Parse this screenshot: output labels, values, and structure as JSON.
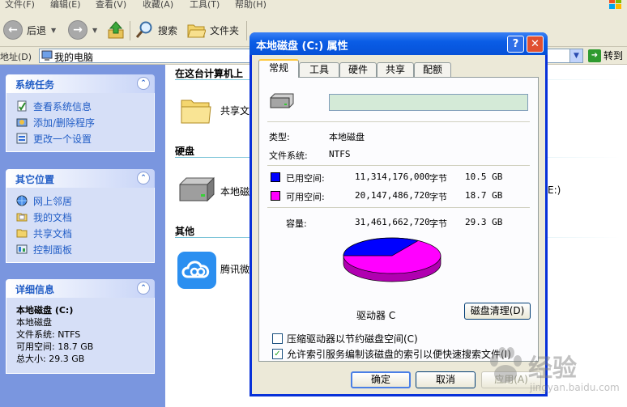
{
  "menubar": {
    "items": [
      "文件(F)",
      "编辑(E)",
      "查看(V)",
      "收藏(A)",
      "工具(T)",
      "帮助(H)"
    ]
  },
  "toolbar": {
    "back_label": "后退",
    "search_label": "搜索",
    "folders_label": "文件夹"
  },
  "addressbar": {
    "label": "地址(D)",
    "value": "我的电脑",
    "go_label": "转到"
  },
  "leftpane": {
    "system_tasks": {
      "title": "系统任务",
      "items": [
        "查看系统信息",
        "添加/删除程序",
        "更改一个设置"
      ]
    },
    "other_places": {
      "title": "其它位置",
      "items": [
        "网上邻居",
        "我的文档",
        "共享文档",
        "控制面板"
      ]
    },
    "details": {
      "title": "详细信息",
      "name": "本地磁盘 (C:)",
      "type": "本地磁盘",
      "filesystem": "文件系统: NTFS",
      "free": "可用空间: 18.7 GB",
      "total": "总大小: 29.3 GB"
    }
  },
  "content": {
    "group_files": "在这台计算机上",
    "shared_docs_label": "共享文",
    "group_disks": "硬盘",
    "local_disk_label": "本地磁",
    "local_disk_suffix": "E:)",
    "group_other": "其他",
    "tencent_label": "腾讯微"
  },
  "dialog": {
    "title": "本地磁盘 (C:) 属性",
    "help_label": "?",
    "close_label": "✕",
    "tabs": [
      "常规",
      "工具",
      "硬件",
      "共享",
      "配额"
    ],
    "active_tab": 0,
    "name_value": "",
    "type_label": "类型:",
    "type_value": "本地磁盘",
    "fs_label": "文件系统:",
    "fs_value": "NTFS",
    "used_label": "已用空间:",
    "used_bytes": "11,314,176,000",
    "used_unit": "字节",
    "used_gb": "10.5 GB",
    "free_label": "可用空间:",
    "free_bytes": "20,147,486,720",
    "free_unit": "字节",
    "free_gb": "18.7 GB",
    "capacity_label": "容量:",
    "capacity_bytes": "31,461,662,720",
    "capacity_unit": "字节",
    "capacity_gb": "29.3 GB",
    "drive_label": "驱动器 C",
    "cleanup_label": "磁盘清理(D)",
    "compress_label": "压缩驱动器以节约磁盘空间(C)",
    "compress_checked": false,
    "index_label": "允许索引服务编制该磁盘的索引以便快速搜索文件(I)",
    "index_checked": true,
    "ok_label": "确定",
    "cancel_label": "取消",
    "apply_label": "应用(A)"
  },
  "colors": {
    "used": "#0000ff",
    "free": "#ff00ff",
    "taskpane": "#7a96df",
    "title_bar": "#0651d8"
  },
  "watermark": {
    "text": "经验",
    "sub": "jingyan.baidu.com"
  }
}
